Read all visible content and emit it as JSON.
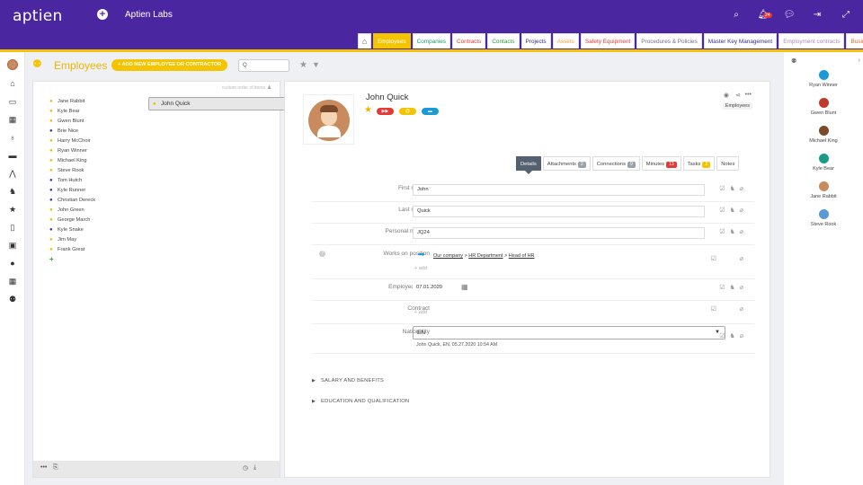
{
  "app": {
    "logo": "aptien",
    "org": "Aptien Labs",
    "notifications_count": "24"
  },
  "tabs": [
    {
      "label": "Employees",
      "color": "#ffffff",
      "active": true
    },
    {
      "label": "Companies",
      "color": "#1a9a6c"
    },
    {
      "label": "Contracts",
      "color": "#e53935"
    },
    {
      "label": "Contacts",
      "color": "#2e9d33"
    },
    {
      "label": "Projects",
      "color": "#3a2a90"
    },
    {
      "label": "Assets",
      "color": "#f0a040"
    },
    {
      "label": "Safety Equipment",
      "color": "#e53935"
    },
    {
      "label": "Procedures & Policies",
      "color": "#7a6a8a"
    },
    {
      "label": "Master Key Management",
      "color": "#3a2a90"
    },
    {
      "label": "Employment contracts",
      "color": "#b08ac0"
    },
    {
      "label": "Business contracts",
      "color": "#e56a30"
    }
  ],
  "page": {
    "title": "Employees",
    "add_button": "+ ADD NEW EMPLOYEE OR CONTRACTOR",
    "search_value": "Q",
    "sort_info": "custom order of items"
  },
  "employees": [
    {
      "name": "John Quick",
      "type": "y",
      "selected": true
    },
    {
      "name": "Jane Rabbit",
      "type": "y"
    },
    {
      "name": "Kyle Bear",
      "type": "y"
    },
    {
      "name": "Gwen Blunt",
      "type": "y"
    },
    {
      "name": "Brie Nice",
      "type": "b"
    },
    {
      "name": "Harry McChoir",
      "type": "y"
    },
    {
      "name": "Ryan Winner",
      "type": "y"
    },
    {
      "name": "Michael King",
      "type": "y"
    },
    {
      "name": "Steve Rook",
      "type": "y"
    },
    {
      "name": "Tom Hutch",
      "type": "b"
    },
    {
      "name": "Kyle Runner",
      "type": "b"
    },
    {
      "name": "Christian Dereck",
      "type": "b"
    },
    {
      "name": "John Green",
      "type": "y"
    },
    {
      "name": "George March",
      "type": "y"
    },
    {
      "name": "Kyle Snake",
      "type": "b"
    },
    {
      "name": "Jim May",
      "type": "y"
    },
    {
      "name": "Frank Great",
      "type": "y"
    }
  ],
  "detail": {
    "name": "John Quick",
    "tag": "Employees",
    "tabs": [
      {
        "label": "Details",
        "active": true
      },
      {
        "label": "Attachments",
        "count": "2",
        "c": "g"
      },
      {
        "label": "Connections",
        "count": "9",
        "c": "g"
      },
      {
        "label": "Minutes",
        "count": "13",
        "c": "r"
      },
      {
        "label": "Tasks",
        "count": "2",
        "c": "o"
      },
      {
        "label": "Notes"
      }
    ],
    "fields": {
      "first_name_label": "First name",
      "first_name": "John",
      "last_name_label": "Last name",
      "last_name": "Quick",
      "personal_number_label": "Personal number",
      "personal_number": "JQ24",
      "position_label": "Works on position",
      "position_path": [
        "Our company",
        "HR Department",
        "Head of HR"
      ],
      "add": "+ add",
      "employed_since_label": "Employed since",
      "employed_since": "07.01.2020",
      "contract_label": "Contract",
      "nationality_label": "Nationality",
      "nationality": "EN",
      "audit": "John Quick, EN, 05.27.2020 10:54 AM"
    },
    "sections": [
      "SALARY AND BENEFITS",
      "EDUCATION AND QUALIFICATION"
    ]
  },
  "right_users": [
    {
      "name": "Ryan Winner",
      "color": "#1a9ad6"
    },
    {
      "name": "Gwen Blunt",
      "color": "#c0392b"
    },
    {
      "name": "Michael King",
      "color": "#7a4a2a"
    },
    {
      "name": "Kyle Bear",
      "color": "#1a9a8a"
    },
    {
      "name": "Jane Rabbit",
      "color": "#c98b5e"
    },
    {
      "name": "Steve Rook",
      "color": "#5a9ad6"
    }
  ]
}
